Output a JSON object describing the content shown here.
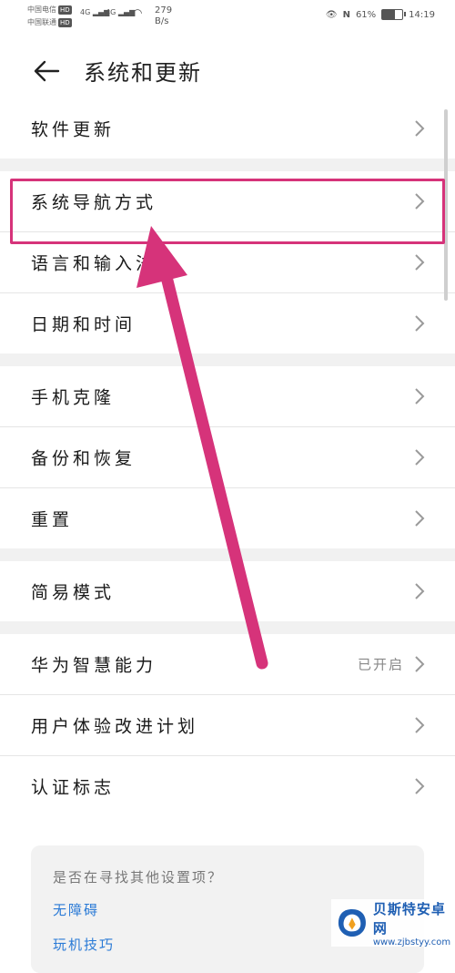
{
  "status_bar": {
    "carrier1": "中国电信",
    "carrier2": "中国联通",
    "hd": "HD",
    "signal1": "4G",
    "signal2": "4G",
    "net_speed_value": "279",
    "net_speed_unit": "B/s",
    "battery_percent": "61%",
    "battery_level": 0.61,
    "time": "14:19"
  },
  "header": {
    "title": "系统和更新"
  },
  "groups": [
    {
      "items": [
        {
          "label": "软件更新"
        }
      ]
    },
    {
      "items": [
        {
          "label": "系统导航方式"
        },
        {
          "label": "语言和输入法"
        },
        {
          "label": "日期和时间"
        }
      ]
    },
    {
      "items": [
        {
          "label": "手机克隆"
        },
        {
          "label": "备份和恢复"
        },
        {
          "label": "重置"
        }
      ]
    },
    {
      "items": [
        {
          "label": "简易模式"
        }
      ]
    },
    {
      "items": [
        {
          "label": "华为智慧能力",
          "value": "已开启"
        },
        {
          "label": "用户体验改进计划"
        },
        {
          "label": "认证标志"
        }
      ]
    }
  ],
  "suggestion": {
    "title": "是否在寻找其他设置项？",
    "link1": "无障碍",
    "link2": "玩机技巧"
  },
  "watermark": {
    "name": "贝斯特安卓网",
    "url": "www.zjbstyy.com"
  },
  "colors": {
    "highlight": "#d6337a",
    "link": "#2a7ad6"
  }
}
